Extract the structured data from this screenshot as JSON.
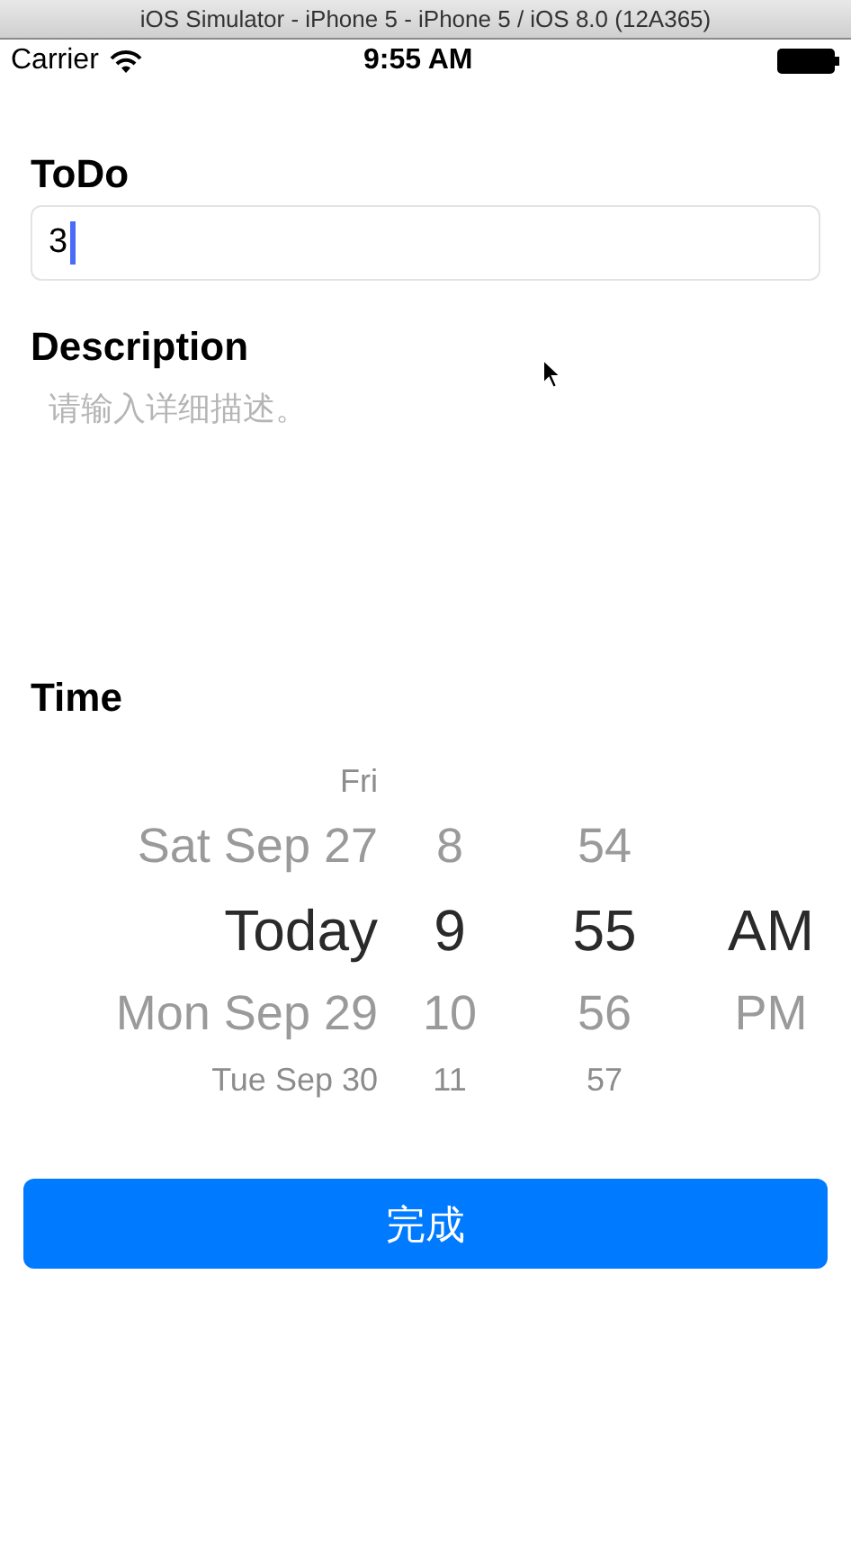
{
  "window": {
    "title": "iOS Simulator - iPhone 5 - iPhone 5 / iOS 8.0 (12A365)"
  },
  "status_bar": {
    "carrier": "Carrier",
    "time": "9:55 AM"
  },
  "todo": {
    "label": "ToDo",
    "value": "3"
  },
  "description": {
    "label": "Description",
    "placeholder": "请输入详细描述。"
  },
  "time": {
    "label": "Time",
    "picker_rows": [
      {
        "date": "Fri",
        "selected": false
      },
      {
        "date": "Sat Sep 27",
        "hour": "8",
        "minute": "54",
        "selected": false
      },
      {
        "date": "Today",
        "hour": "9",
        "minute": "55",
        "period": "AM",
        "selected": true
      },
      {
        "date": "Mon Sep 29",
        "hour": "10",
        "minute": "56",
        "period": "PM",
        "selected": false
      },
      {
        "date": "Tue Sep 30",
        "hour": "11",
        "minute": "57",
        "selected": false
      }
    ]
  },
  "done_button": "完成"
}
